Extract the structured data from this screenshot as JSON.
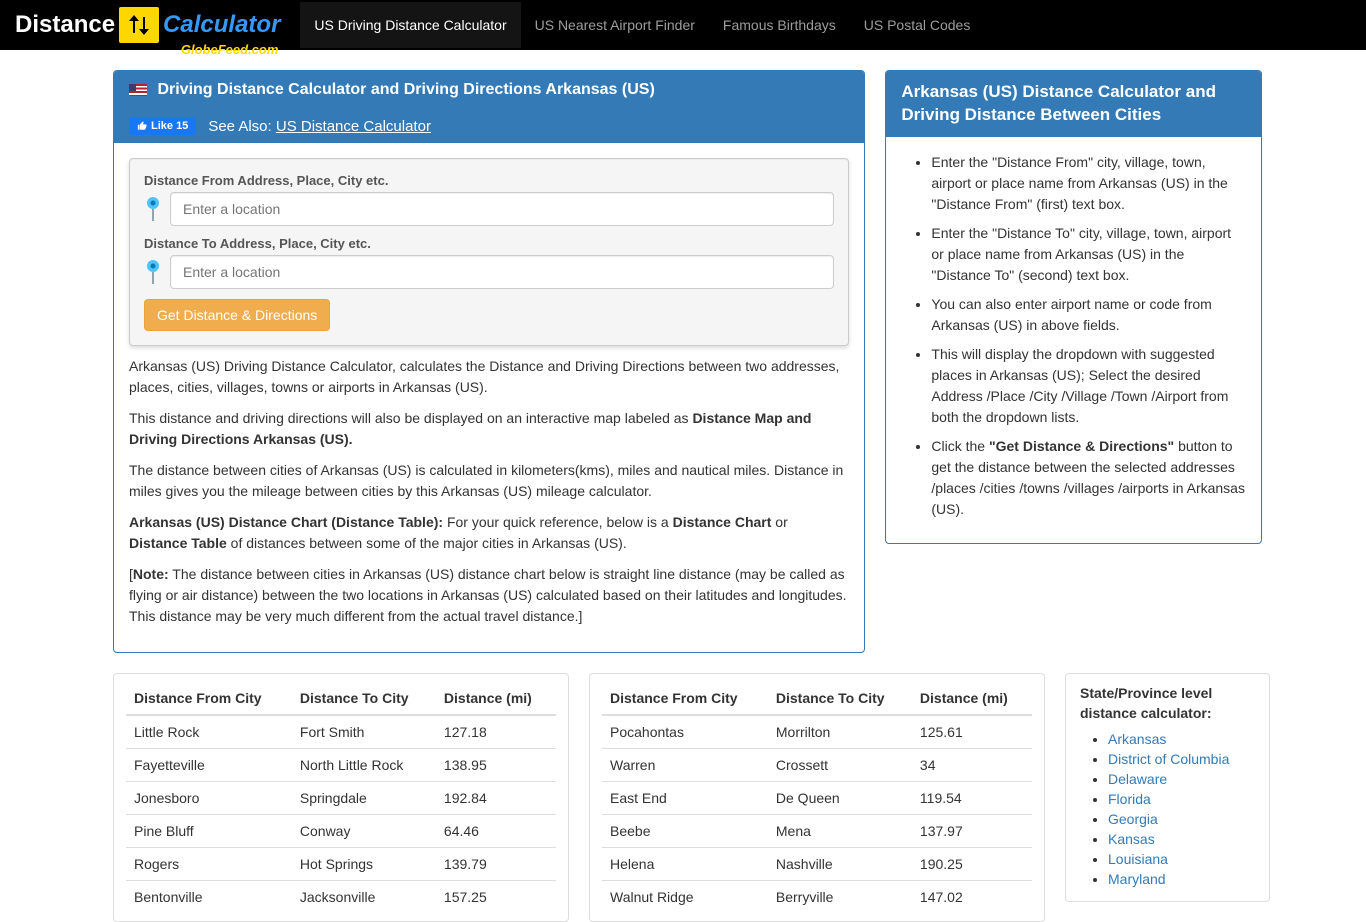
{
  "brand": {
    "part1": "Distance",
    "part2": "Calculator",
    "sub": "GlobeFeed.com"
  },
  "nav": [
    {
      "label": "US Driving Distance Calculator",
      "active": true
    },
    {
      "label": "US Nearest Airport Finder",
      "active": false
    },
    {
      "label": "Famous Birthdays",
      "active": false
    },
    {
      "label": "US Postal Codes",
      "active": false
    }
  ],
  "main": {
    "heading": "Driving Distance Calculator and Driving Directions Arkansas (US)",
    "like": "Like 15",
    "see_also_label": "See Also:",
    "see_also_link": "US Distance Calculator",
    "form": {
      "from_label": "Distance From Address, Place, City etc.",
      "to_label": "Distance To Address, Place, City etc.",
      "placeholder": "Enter a location",
      "button": "Get Distance & Directions"
    },
    "desc": {
      "p1": "Arkansas (US) Driving Distance Calculator, calculates the Distance and Driving Directions between two addresses, places, cities, villages, towns or airports in Arkansas (US).",
      "p2a": "This distance and driving directions will also be displayed on an interactive map labeled as ",
      "p2b": "Distance Map and Driving Directions Arkansas (US).",
      "p3": "The distance between cities of Arkansas (US) is calculated in kilometers(kms), miles and nautical miles. Distance in miles gives you the mileage between cities by this Arkansas (US) mileage calculator.",
      "p4a": "Arkansas (US) Distance Chart (Distance Table):",
      "p4b": " For your quick reference, below is a ",
      "p4c": "Distance Chart",
      "p4d": " or ",
      "p4e": "Distance Table",
      "p4f": " of distances between some of the major cities in Arkansas (US).",
      "p5a": "[",
      "p5b": "Note:",
      "p5c": " The distance between cities in Arkansas (US) distance chart below is straight line distance (may be called as flying or air distance) between the two locations in Arkansas (US) calculated based on their latitudes and longitudes. This distance may be very much different from the actual travel distance.]"
    }
  },
  "side": {
    "heading": "Arkansas (US) Distance Calculator and Driving Distance Between Cities",
    "items": [
      "Enter the \"Distance From\" city, village, town, airport or place name from Arkansas (US) in the \"Distance From\" (first) text box.",
      "Enter the \"Distance To\" city, village, town, airport or place name from Arkansas (US) in the \"Distance To\" (second) text box.",
      "You can also enter airport name or code from Arkansas (US) in above fields.",
      "This will display the dropdown with suggested places in Arkansas (US); Select the desired Address /Place /City /Village /Town /Airport from both the dropdown lists."
    ],
    "last_a": "Click the ",
    "last_b": "\"Get Distance & Directions\"",
    "last_c": " button to get the distance between the selected addresses /places /cities /towns /villages /airports in Arkansas (US)."
  },
  "table_headers": {
    "from": "Distance From City",
    "to": "Distance To City",
    "dist": "Distance (mi)"
  },
  "table1": [
    {
      "from": "Little Rock",
      "to": "Fort Smith",
      "dist": "127.18"
    },
    {
      "from": "Fayetteville",
      "to": "North Little Rock",
      "dist": "138.95"
    },
    {
      "from": "Jonesboro",
      "to": "Springdale",
      "dist": "192.84"
    },
    {
      "from": "Pine Bluff",
      "to": "Conway",
      "dist": "64.46"
    },
    {
      "from": "Rogers",
      "to": "Hot Springs",
      "dist": "139.79"
    },
    {
      "from": "Bentonville",
      "to": "Jacksonville",
      "dist": "157.25"
    }
  ],
  "table2": [
    {
      "from": "Pocahontas",
      "to": "Morrilton",
      "dist": "125.61"
    },
    {
      "from": "Warren",
      "to": "Crossett",
      "dist": "34"
    },
    {
      "from": "East End",
      "to": "De Queen",
      "dist": "119.54"
    },
    {
      "from": "Beebe",
      "to": "Mena",
      "dist": "137.97"
    },
    {
      "from": "Helena",
      "to": "Nashville",
      "dist": "190.25"
    },
    {
      "from": "Walnut Ridge",
      "to": "Berryville",
      "dist": "147.02"
    }
  ],
  "states": {
    "heading": "State/Province level distance calculator:",
    "items": [
      "Arkansas",
      "District of Columbia",
      "Delaware",
      "Florida",
      "Georgia",
      "Kansas",
      "Louisiana",
      "Maryland"
    ]
  }
}
